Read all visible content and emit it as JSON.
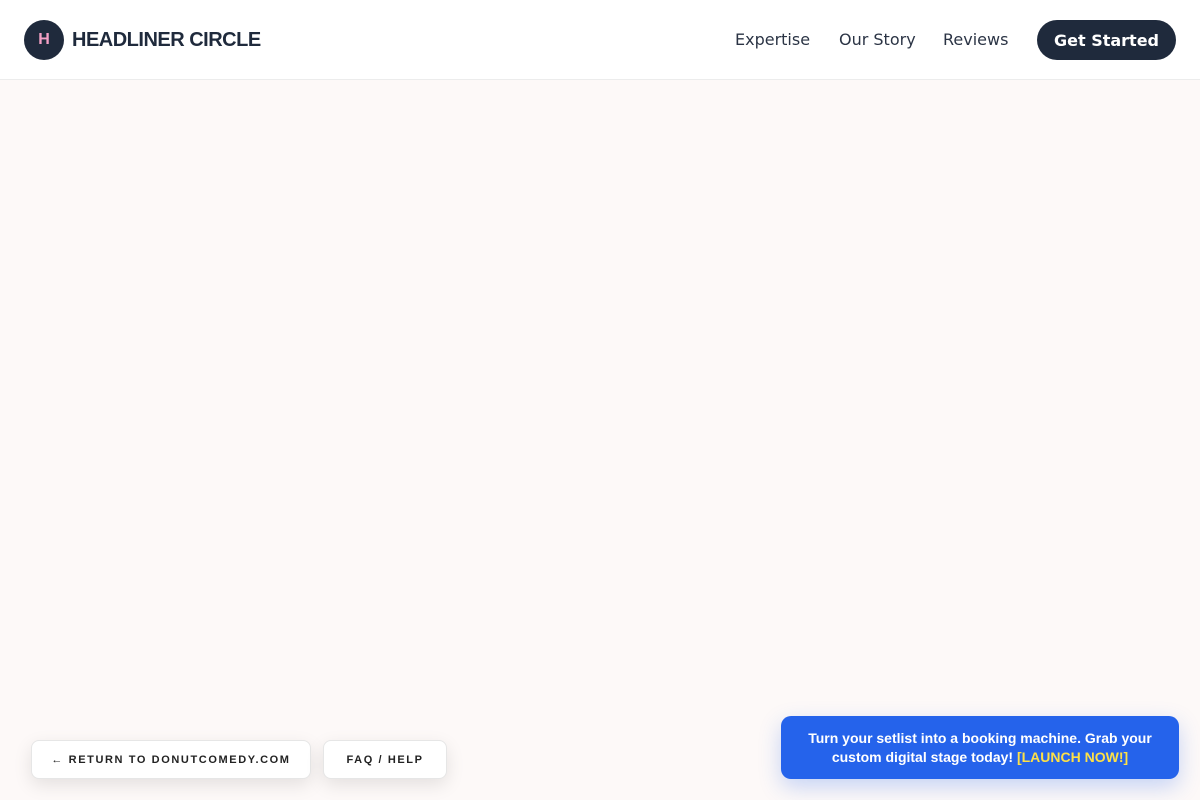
{
  "header": {
    "logo_letter": "H",
    "brand": "HEADLINER CIRCLE",
    "nav": [
      {
        "label": "Expertise"
      },
      {
        "label": "Our Story"
      },
      {
        "label": "Reviews"
      }
    ],
    "cta_label": "Get Started"
  },
  "footer_buttons": {
    "return_label": "← RETURN TO DONUTCOMEDY.COM",
    "faq_label": "FAQ / HELP"
  },
  "promo_banner": {
    "text": "Turn your setlist into a booking machine. Grab your custom digital stage today!",
    "link_label": "[LAUNCH NOW!]"
  },
  "colors": {
    "page_background": "#fdf9f8",
    "navy": "#1f2a3c",
    "logo_letter": "#f5a0c6",
    "banner_blue": "#2563eb",
    "banner_link": "#fde047"
  }
}
